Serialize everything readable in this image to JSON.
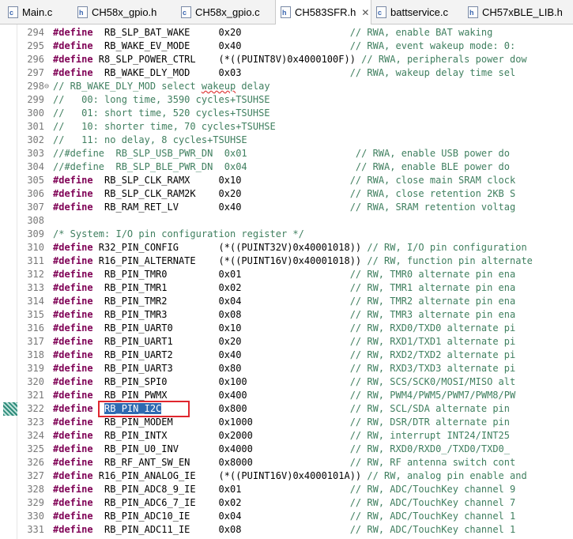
{
  "tabs": [
    {
      "label": "Main.c",
      "icon": "c",
      "active": false
    },
    {
      "label": "CH58x_gpio.h",
      "icon": "h",
      "active": false
    },
    {
      "label": "CH58x_gpio.c",
      "icon": "c",
      "active": false
    },
    {
      "label": "CH583SFR.h",
      "icon": "h",
      "active": true
    },
    {
      "label": "battservice.c",
      "icon": "c",
      "active": false
    },
    {
      "label": "CH57xBLE_LIB.h",
      "icon": "h",
      "active": false
    }
  ],
  "close_glyph": "✕",
  "lines": [
    {
      "n": "294",
      "k": "#define",
      "sym": "  RB_SLP_BAT_WAKE",
      "pad": "     ",
      "val": "0x20",
      "cpad": "                   ",
      "cm": "// RWA, enable BAT waking"
    },
    {
      "n": "295",
      "k": "#define",
      "sym": "  RB_WAKE_EV_MODE",
      "pad": "     ",
      "val": "0x40",
      "cpad": "                   ",
      "cm": "// RWA, event wakeup mode: 0:"
    },
    {
      "n": "296",
      "k": "#define",
      "sym": " R8_SLP_POWER_CTRL",
      "pad": "    ",
      "val": "(*((PUINT8V)0x4000100F))",
      "cpad": " ",
      "cm": "// RWA, peripherals power dow"
    },
    {
      "n": "297",
      "k": "#define",
      "sym": "  RB_WAKE_DLY_MOD",
      "pad": "     ",
      "val": "0x03",
      "cpad": "                   ",
      "cm": "// RWA, wakeup delay time sel"
    },
    {
      "n": "298",
      "fold": "⊖",
      "cm": "// RB_WAKE_DLY_MOD select wakeup delay"
    },
    {
      "n": "299",
      "cm": "//   00: long time, 3590 cycles+TSUHSE"
    },
    {
      "n": "300",
      "cm": "//   01: short time, 520 cycles+TSUHSE"
    },
    {
      "n": "301",
      "cm": "//   10: shorter time, 70 cycles+TSUHSE"
    },
    {
      "n": "302",
      "cm": "//   11: no delay, 8 cycles+TSUHSE"
    },
    {
      "n": "303",
      "cm": "//#define  RB_SLP_USB_PWR_DN  0x01                   // RWA, enable USB power do"
    },
    {
      "n": "304",
      "cm": "//#define  RB_SLP_BLE_PWR_DN  0x04                   // RWA, enable BLE power do"
    },
    {
      "n": "305",
      "k": "#define",
      "sym": "  RB_SLP_CLK_RAMX",
      "pad": "     ",
      "val": "0x10",
      "cpad": "                   ",
      "cm": "// RWA, close main SRAM clock"
    },
    {
      "n": "306",
      "k": "#define",
      "sym": "  RB_SLP_CLK_RAM2K",
      "pad": "    ",
      "val": "0x20",
      "cpad": "                   ",
      "cm": "// RWA, close retention 2KB S"
    },
    {
      "n": "307",
      "k": "#define",
      "sym": "  RB_RAM_RET_LV",
      "pad": "       ",
      "val": "0x40",
      "cpad": "                   ",
      "cm": "// RWA, SRAM retention voltag"
    },
    {
      "n": "308"
    },
    {
      "n": "309",
      "cm": "/* System: I/O pin configuration register */"
    },
    {
      "n": "310",
      "k": "#define",
      "sym": " R32_PIN_CONFIG",
      "pad": "       ",
      "val": "(*((PUINT32V)0x40001018))",
      "cpad": " ",
      "cm": "// RW, I/O pin configuration"
    },
    {
      "n": "311",
      "k": "#define",
      "sym": " R16_PIN_ALTERNATE",
      "pad": "    ",
      "val": "(*((PUINT16V)0x40001018))",
      "cpad": " ",
      "cm": "// RW, function pin alternate"
    },
    {
      "n": "312",
      "k": "#define",
      "sym": "  RB_PIN_TMR0",
      "pad": "         ",
      "val": "0x01",
      "cpad": "                   ",
      "cm": "// RW, TMR0 alternate pin ena"
    },
    {
      "n": "313",
      "k": "#define",
      "sym": "  RB_PIN_TMR1",
      "pad": "         ",
      "val": "0x02",
      "cpad": "                   ",
      "cm": "// RW, TMR1 alternate pin ena"
    },
    {
      "n": "314",
      "k": "#define",
      "sym": "  RB_PIN_TMR2",
      "pad": "         ",
      "val": "0x04",
      "cpad": "                   ",
      "cm": "// RW, TMR2 alternate pin ena"
    },
    {
      "n": "315",
      "k": "#define",
      "sym": "  RB_PIN_TMR3",
      "pad": "         ",
      "val": "0x08",
      "cpad": "                   ",
      "cm": "// RW, TMR3 alternate pin ena"
    },
    {
      "n": "316",
      "k": "#define",
      "sym": "  RB_PIN_UART0",
      "pad": "        ",
      "val": "0x10",
      "cpad": "                   ",
      "cm": "// RW, RXD0/TXD0 alternate pi"
    },
    {
      "n": "317",
      "k": "#define",
      "sym": "  RB_PIN_UART1",
      "pad": "        ",
      "val": "0x20",
      "cpad": "                   ",
      "cm": "// RW, RXD1/TXD1 alternate pi"
    },
    {
      "n": "318",
      "k": "#define",
      "sym": "  RB_PIN_UART2",
      "pad": "        ",
      "val": "0x40",
      "cpad": "                   ",
      "cm": "// RW, RXD2/TXD2 alternate pi"
    },
    {
      "n": "319",
      "k": "#define",
      "sym": "  RB_PIN_UART3",
      "pad": "        ",
      "val": "0x80",
      "cpad": "                   ",
      "cm": "// RW, RXD3/TXD3 alternate pi"
    },
    {
      "n": "320",
      "k": "#define",
      "sym": "  RB_PIN_SPI0",
      "pad": "         ",
      "val": "0x100",
      "cpad": "                  ",
      "cm": "// RW, SCS/SCK0/MOSI/MISO alt"
    },
    {
      "n": "321",
      "k": "#define",
      "sym": "  RB_PIN_PWMX",
      "pad": "         ",
      "val": "0x400",
      "cpad": "                  ",
      "cm": "// RW, PWM4/PWM5/PWM7/PWM8/PW"
    },
    {
      "n": "322",
      "k": "#define",
      "sym": "  RB_PIN_I2C",
      "pad": "          ",
      "val": "0x800",
      "cpad": "                  ",
      "cm": "// RW, SCL/SDA alternate pin",
      "selected": true
    },
    {
      "n": "323",
      "k": "#define",
      "sym": "  RB_PIN_MODEM",
      "pad": "        ",
      "val": "0x1000",
      "cpad": "                 ",
      "cm": "// RW, DSR/DTR alternate pin"
    },
    {
      "n": "324",
      "k": "#define",
      "sym": "  RB_PIN_INTX",
      "pad": "         ",
      "val": "0x2000",
      "cpad": "                 ",
      "cm": "// RW, interrupt INT24/INT25"
    },
    {
      "n": "325",
      "k": "#define",
      "sym": "  RB_PIN_U0_INV",
      "pad": "       ",
      "val": "0x4000",
      "cpad": "                 ",
      "cm": "// RW, RXD0/RXD0_/TXD0/TXD0_"
    },
    {
      "n": "326",
      "k": "#define",
      "sym": "  RB_RF_ANT_SW_EN",
      "pad": "     ",
      "val": "0x8000",
      "cpad": "                 ",
      "cm": "// RW, RF antenna switch cont"
    },
    {
      "n": "327",
      "k": "#define",
      "sym": " R16_PIN_ANALOG_IE",
      "pad": "    ",
      "val": "(*((PUINT16V)0x4000101A))",
      "cpad": " ",
      "cm": "// RW, analog pin enable and"
    },
    {
      "n": "328",
      "k": "#define",
      "sym": "  RB_PIN_ADC8_9_IE",
      "pad": "    ",
      "val": "0x01",
      "cpad": "                   ",
      "cm": "// RW, ADC/TouchKey channel 9"
    },
    {
      "n": "329",
      "k": "#define",
      "sym": "  RB_PIN_ADC6_7_IE",
      "pad": "    ",
      "val": "0x02",
      "cpad": "                   ",
      "cm": "// RW, ADC/TouchKey channel 7"
    },
    {
      "n": "330",
      "k": "#define",
      "sym": "  RB_PIN_ADC10_IE",
      "pad": "     ",
      "val": "0x04",
      "cpad": "                   ",
      "cm": "// RW, ADC/TouchKey channel 1"
    },
    {
      "n": "331",
      "k": "#define",
      "sym": "  RB_PIN_ADC11_IE",
      "pad": "     ",
      "val": "0x08",
      "cpad": "                   ",
      "cm": "// RW, ADC/TouchKey channel 1"
    }
  ]
}
